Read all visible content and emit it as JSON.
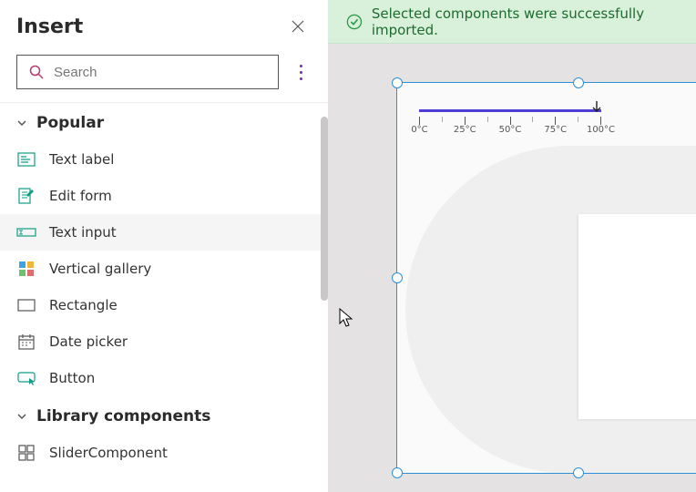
{
  "panel": {
    "title": "Insert",
    "search_placeholder": "Search"
  },
  "sections": {
    "popular": {
      "label": "Popular",
      "items": [
        {
          "label": "Text label"
        },
        {
          "label": "Edit form"
        },
        {
          "label": "Text input"
        },
        {
          "label": "Vertical gallery"
        },
        {
          "label": "Rectangle"
        },
        {
          "label": "Date picker"
        },
        {
          "label": "Button"
        }
      ]
    },
    "library": {
      "label": "Library components",
      "items": [
        {
          "label": "SliderComponent"
        }
      ]
    }
  },
  "notification": {
    "text": "Selected components were successfully imported."
  },
  "slider": {
    "ticks": [
      "0°C",
      "25°C",
      "50°C",
      "75°C",
      "100°C"
    ]
  },
  "colors": {
    "accent": "#4f3ed6",
    "selection": "#2d8fd6",
    "notif_bg": "#d9f0db",
    "notif_fg": "#1e6b2f"
  }
}
